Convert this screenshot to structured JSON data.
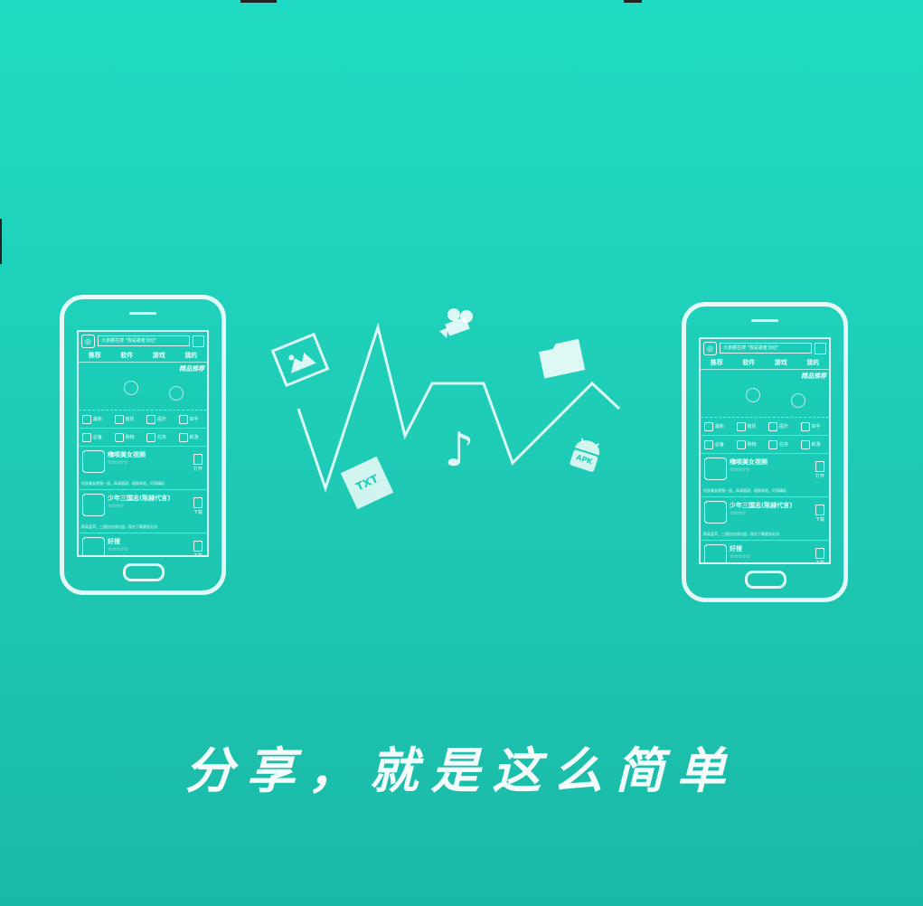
{
  "slogan": "分享，就是这么简单",
  "phones": [
    {
      "search_placeholder": "大家都在搜 \"我是歌者活动\"",
      "tabs": [
        "推荐",
        "软件",
        "游戏",
        "我的"
      ],
      "banner_badge": "精品推荐",
      "categories": [
        "最新",
        "装机",
        "提升",
        "高手",
        "必备",
        "购物",
        "任务",
        "新游"
      ],
      "apps": [
        {
          "name": "嗨呗美女视频",
          "stars": "☆☆☆☆☆",
          "action": "打开",
          "desc": "优质美女视频一览、高清画质、极致体验、尽享精彩"
        },
        {
          "name": "少年三国志(陈赫代言)",
          "stars": "☆☆☆☆",
          "action": "下载",
          "desc": "群英荟萃，三国志在线对战，现在下载就送礼包"
        },
        {
          "name": "好搜",
          "stars": "☆☆☆☆☆",
          "action": "下载",
          "desc": ""
        }
      ]
    },
    {
      "search_placeholder": "大家都在搜 \"我是歌者活动\"",
      "tabs": [
        "推荐",
        "软件",
        "游戏",
        "我的"
      ],
      "banner_badge": "精品推荐",
      "categories": [
        "最新",
        "装机",
        "提升",
        "高手",
        "必备",
        "购物",
        "任务",
        "新游"
      ],
      "apps": [
        {
          "name": "嗨呗美女视频",
          "stars": "☆☆☆☆☆",
          "action": "打开",
          "desc": "优质美女视频一览、高清画质、极致体验、尽享精彩"
        },
        {
          "name": "少年三国志(陈赫代言)",
          "stars": "☆☆☆☆",
          "action": "下载",
          "desc": "群英荟萃，三国志在线对战，现在下载就送礼包"
        },
        {
          "name": "好搜",
          "stars": "☆☆☆☆☆",
          "action": "下载",
          "desc": ""
        }
      ]
    }
  ],
  "floating_icons": {
    "txt_label": "TXT",
    "apk_label": "APK",
    "music_glyph": "♪",
    "camera_glyph": "🎥"
  },
  "colors": {
    "background_top": "#20dbc3",
    "background_bottom": "#1ab9a6",
    "line": "#ffffff"
  }
}
